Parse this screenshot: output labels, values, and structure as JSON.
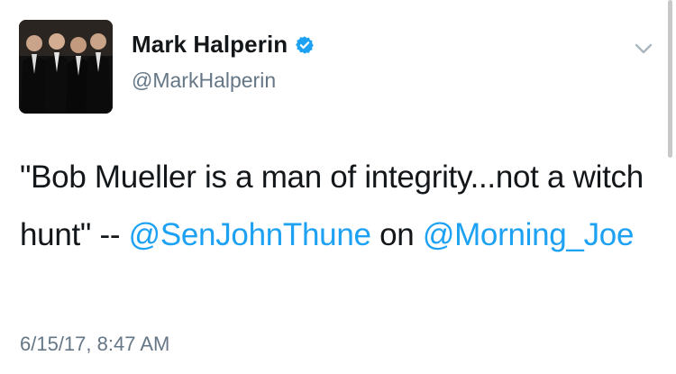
{
  "tweet": {
    "author": {
      "display_name": "Mark Halperin",
      "handle": "@MarkHalperin",
      "avatar_icon": "profile-photo",
      "verified_icon": "verified-badge-icon"
    },
    "menu_icon": "chevron-down-icon",
    "text": {
      "part1": "\"Bob Mueller is a man of integrity...not a witch hunt\" -- ",
      "mention1": "@SenJohnThune",
      "part2": " on ",
      "mention2": "@Morning_Joe"
    },
    "timestamp": "6/15/17, 8:47 AM"
  },
  "colors": {
    "link": "#1da1f2",
    "verified": "#1da1f2",
    "secondary": "#657786",
    "text": "#14171a"
  }
}
